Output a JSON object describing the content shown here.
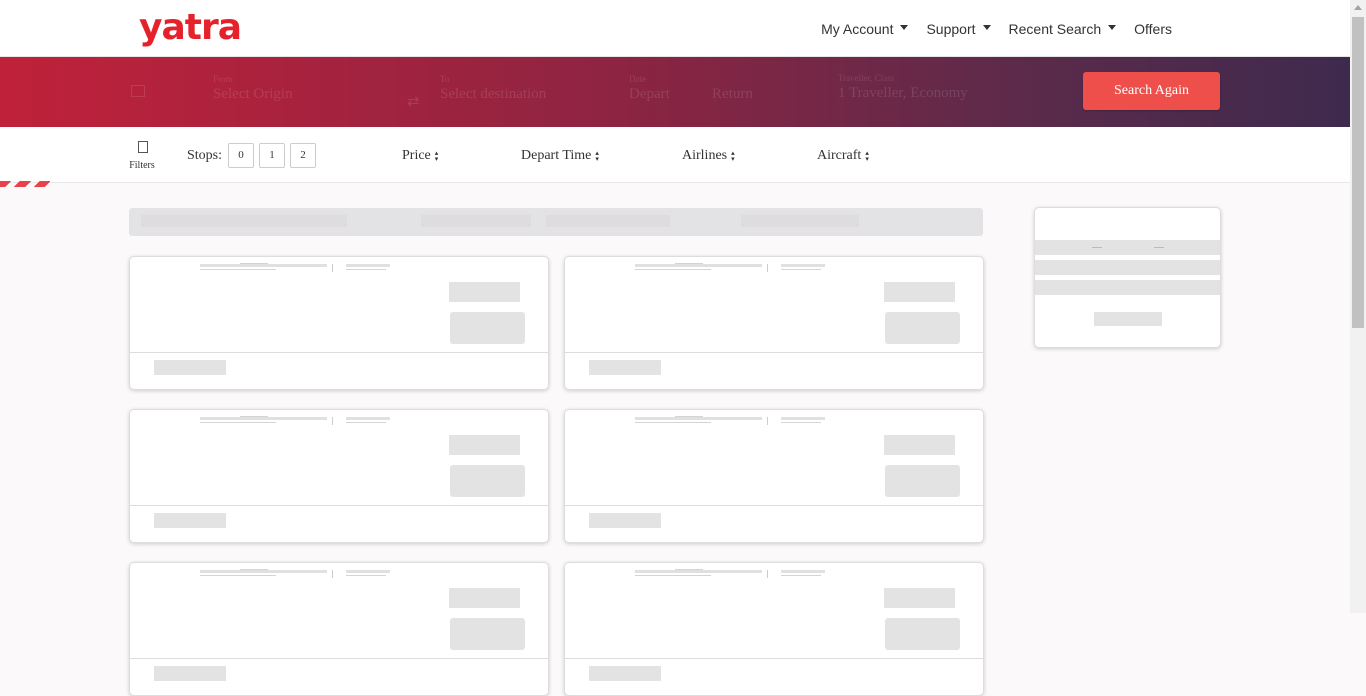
{
  "brand": {
    "logo_text": "yatra",
    "color": "#e5222c"
  },
  "nav": {
    "items": [
      {
        "label": "My Account",
        "has_dropdown": true
      },
      {
        "label": "Support",
        "has_dropdown": true
      },
      {
        "label": "Recent Search",
        "has_dropdown": true
      },
      {
        "label": "Offers",
        "has_dropdown": false
      }
    ]
  },
  "search": {
    "origin_label": "From",
    "origin_placeholder": "Select Origin",
    "destination_label": "To",
    "destination_placeholder": "Select destination",
    "depart_label": "Date",
    "depart_placeholder": "Depart",
    "return_placeholder": "Return",
    "travellers_label": "Traveller, Class",
    "travellers_value": "1 Traveller, Economy",
    "button_label": "Search Again",
    "button_color": "#ef4f4b"
  },
  "filters": {
    "toggle_label": "Filters",
    "stops_label": "Stops:",
    "stops": [
      "0",
      "1",
      "2"
    ],
    "sort_options": [
      {
        "label": "Price"
      },
      {
        "label": "Depart Time"
      },
      {
        "label": "Airlines"
      },
      {
        "label": "Aircraft"
      }
    ],
    "sort_icon": "sort-arrows-icon"
  },
  "results": {
    "state": "loading",
    "skeleton_cards": 6,
    "sidebar_skeleton_cards": 1
  }
}
